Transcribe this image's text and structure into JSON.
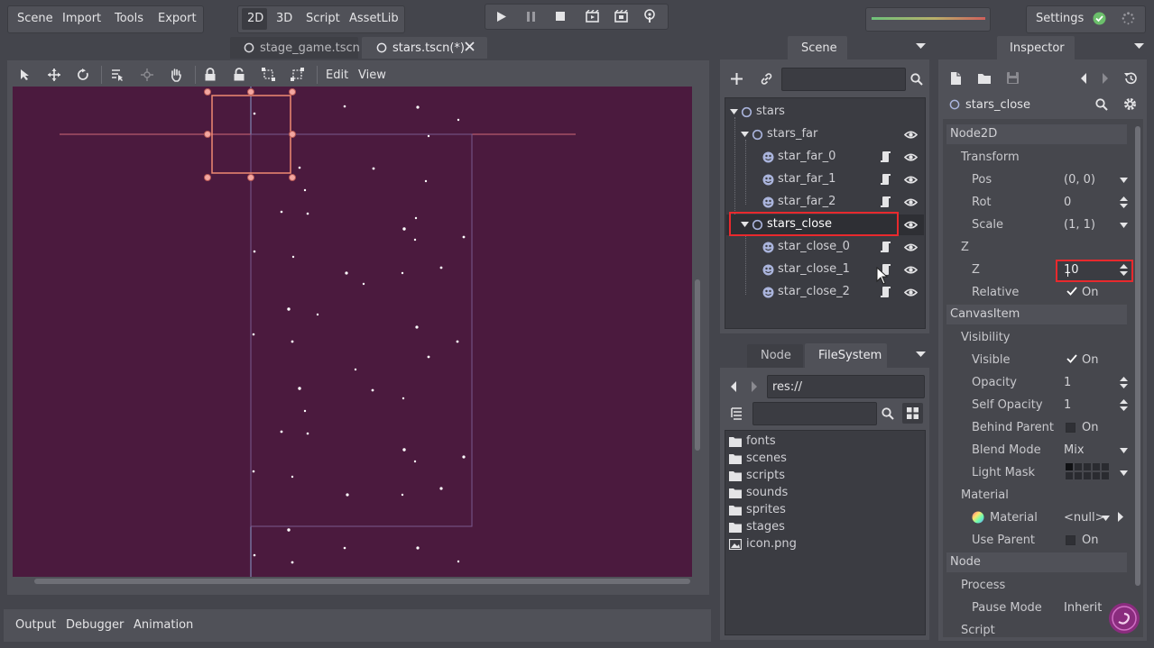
{
  "menubar": {
    "items": [
      "Scene",
      "Import",
      "Tools",
      "Export"
    ]
  },
  "modes": {
    "items": [
      "2D",
      "3D",
      "Script",
      "AssetLib"
    ],
    "active": "2D"
  },
  "settings_label": "Settings",
  "tabs": {
    "items": [
      "stage_game.tscn",
      "stars.tscn(*)"
    ],
    "active": 1
  },
  "viewport_toolbar": {
    "edit": "Edit",
    "view": "View"
  },
  "bottom_tabs": [
    "Output",
    "Debugger",
    "Animation"
  ],
  "scene_dock": {
    "title": "Scene",
    "tree": [
      {
        "label": "stars",
        "type": "node2d",
        "depth": 0,
        "expanded": true
      },
      {
        "label": "stars_far",
        "type": "node2d",
        "depth": 1,
        "expanded": true,
        "visible": true
      },
      {
        "label": "star_far_0",
        "type": "sprite",
        "depth": 2,
        "visible": true
      },
      {
        "label": "star_far_1",
        "type": "sprite",
        "depth": 2,
        "visible": true
      },
      {
        "label": "star_far_2",
        "type": "sprite",
        "depth": 2,
        "visible": true
      },
      {
        "label": "stars_close",
        "type": "node2d",
        "depth": 1,
        "expanded": true,
        "visible": true,
        "selected": true
      },
      {
        "label": "star_close_0",
        "type": "sprite",
        "depth": 2,
        "visible": true
      },
      {
        "label": "star_close_1",
        "type": "sprite",
        "depth": 2,
        "visible": true
      },
      {
        "label": "star_close_2",
        "type": "sprite",
        "depth": 2,
        "visible": true
      }
    ]
  },
  "filesystem_dock": {
    "tabs": [
      "Node",
      "FileSystem"
    ],
    "active": "FileSystem",
    "path": "res://",
    "items": [
      {
        "label": "fonts",
        "type": "folder"
      },
      {
        "label": "scenes",
        "type": "folder"
      },
      {
        "label": "scripts",
        "type": "folder"
      },
      {
        "label": "sounds",
        "type": "folder"
      },
      {
        "label": "sprites",
        "type": "folder"
      },
      {
        "label": "stages",
        "type": "folder"
      },
      {
        "label": "icon.png",
        "type": "image"
      }
    ]
  },
  "inspector": {
    "title": "Inspector",
    "node_name": "stars_close",
    "node2d_section": "Node2D",
    "transform_label": "Transform",
    "pos_label": "Pos",
    "pos_value": "(0, 0)",
    "rot_label": "Rot",
    "rot_value": "0",
    "scale_label": "Scale",
    "scale_value": "(1, 1)",
    "z_group": "Z",
    "z_label": "Z",
    "z_value": "10",
    "relative_label": "Relative",
    "relative_value": "On",
    "canvasitem_section": "CanvasItem",
    "visibility_label": "Visibility",
    "visible_label": "Visible",
    "visible_value": "On",
    "opacity_label": "Opacity",
    "opacity_value": "1",
    "self_opacity_label": "Self Opacity",
    "self_opacity_value": "1",
    "behind_parent_label": "Behind Parent",
    "behind_parent_value": "On",
    "blend_mode_label": "Blend Mode",
    "blend_mode_value": "Mix",
    "light_mask_label": "Light Mask",
    "material_group": "Material",
    "material_label": "Material",
    "material_value": "<null>",
    "use_parent_label": "Use Parent",
    "use_parent_value": "On",
    "node_section": "Node",
    "process_label": "Process",
    "pause_mode_label": "Pause Mode",
    "pause_mode_value": "Inherit",
    "script_label": "Script"
  },
  "colors": {
    "accent_red": "#e8292d",
    "viewport_bg": "#4b1a3e",
    "selection": "#ef8a72"
  }
}
